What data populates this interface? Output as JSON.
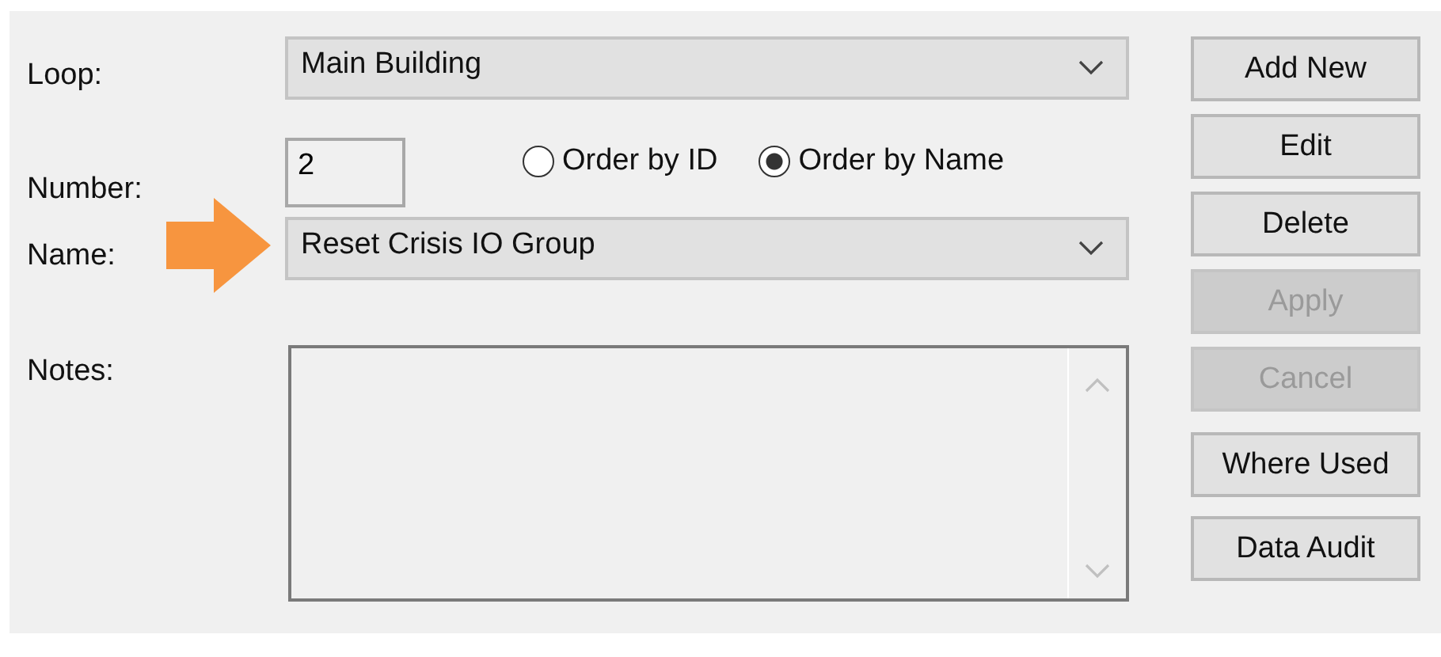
{
  "form": {
    "loop": {
      "label": "Loop:",
      "value": "Main Building"
    },
    "number": {
      "label": "Number:",
      "value": "2"
    },
    "order_options": [
      {
        "label": "Order by ID",
        "selected": false
      },
      {
        "label": "Order by Name",
        "selected": true
      }
    ],
    "name": {
      "label": "Name:",
      "value": "Reset Crisis IO Group"
    },
    "notes": {
      "label": "Notes:"
    }
  },
  "buttons": [
    {
      "label": "Add New",
      "disabled": false
    },
    {
      "label": "Edit",
      "disabled": false
    },
    {
      "label": "Delete",
      "disabled": false
    },
    {
      "label": "Apply",
      "disabled": true
    },
    {
      "label": "Cancel",
      "disabled": true
    }
  ],
  "extra_buttons": [
    {
      "label": "Where Used",
      "disabled": false
    },
    {
      "label": "Data Audit",
      "disabled": false
    }
  ]
}
